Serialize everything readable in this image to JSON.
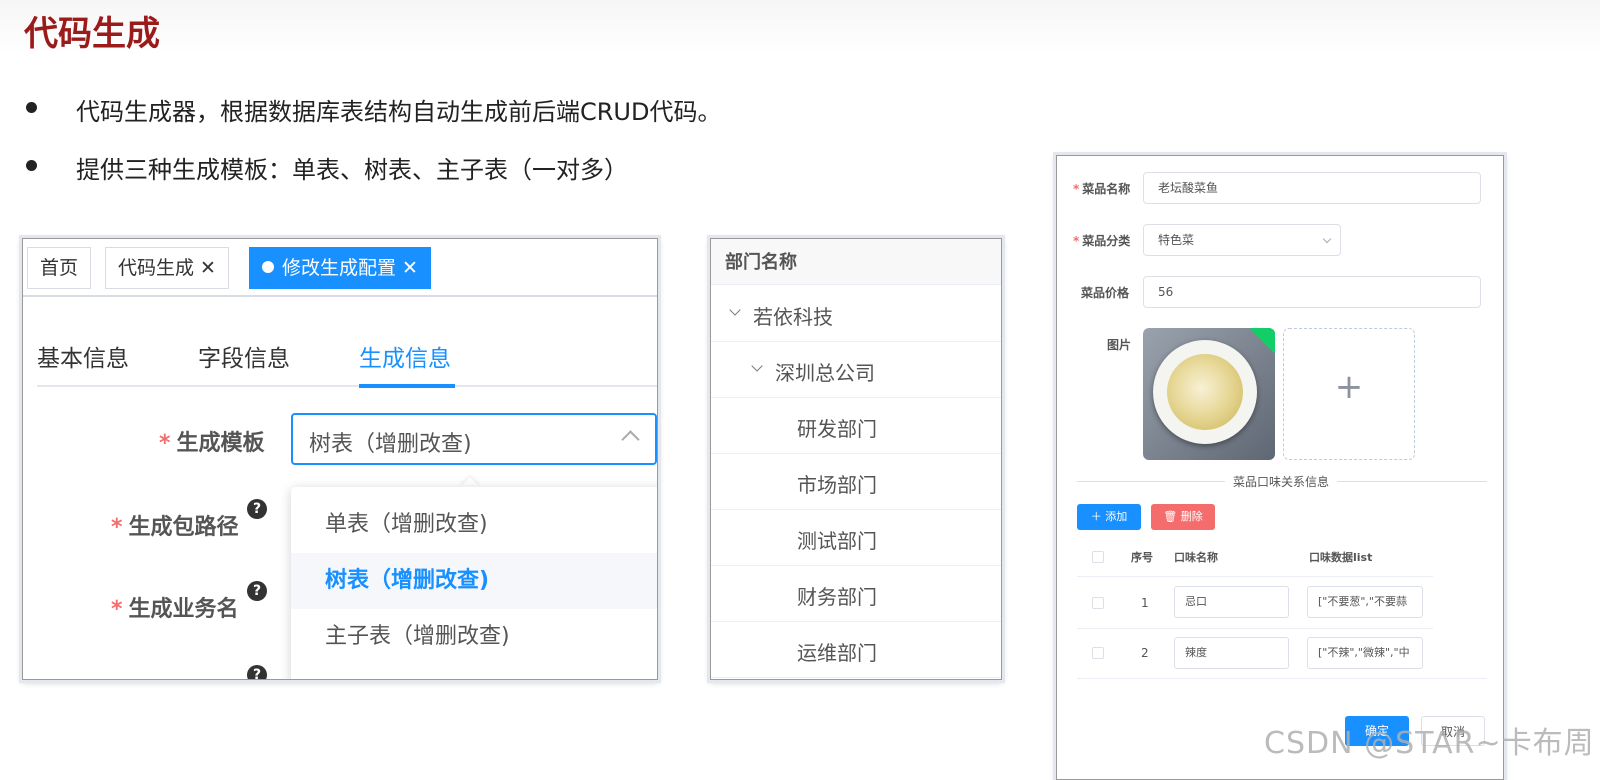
{
  "slide": {
    "title": "代码生成",
    "bullets": [
      "代码生成器，根据数据库表结构自动生成前后端CRUD代码。",
      "提供三种生成模板：单表、树表、主子表（一对多）"
    ]
  },
  "codegen_panel": {
    "tags": [
      {
        "label": "首页"
      },
      {
        "label": "代码生成",
        "close": "✕"
      },
      {
        "label": "修改生成配置",
        "close": "✕"
      }
    ],
    "tabs": [
      "基本信息",
      "字段信息",
      "生成信息"
    ],
    "active_tab": "生成信息",
    "fields": {
      "template": {
        "label": "生成模板",
        "value": "树表（增删改查)"
      },
      "package_path": {
        "label": "生成包路径"
      },
      "business_name": {
        "label": "生成业务名"
      }
    },
    "dropdown_options": [
      "单表（增删改查)",
      "树表（增删改查)",
      "主子表（增删改查)"
    ],
    "selected_option": "树表（增删改查)",
    "help_glyph": "?"
  },
  "tree_panel": {
    "header": "部门名称",
    "rows": [
      {
        "label": "若依科技",
        "level": 0,
        "expanded": true
      },
      {
        "label": "深圳总公司",
        "level": 1,
        "expanded": true
      },
      {
        "label": "研发部门",
        "level": 2
      },
      {
        "label": "市场部门",
        "level": 2
      },
      {
        "label": "测试部门",
        "level": 2
      },
      {
        "label": "财务部门",
        "level": 2
      },
      {
        "label": "运维部门",
        "level": 2
      }
    ]
  },
  "dish_form": {
    "name": {
      "label": "菜品名称",
      "value": "老坛酸菜鱼"
    },
    "category": {
      "label": "菜品分类",
      "value": "特色菜"
    },
    "price": {
      "label": "菜品价格",
      "value": "56"
    },
    "image": {
      "label": "图片",
      "upload_icon": "+"
    },
    "section_title": "菜品口味关系信息",
    "add_button": "＋ 添加",
    "delete_button": "🗑 删除",
    "table": {
      "headers": [
        "序号",
        "口味名称",
        "口味数据list"
      ],
      "rows": [
        {
          "index": "1",
          "name": "忌口",
          "list": "[\"不要葱\",\"不要蒜"
        },
        {
          "index": "2",
          "name": "辣度",
          "list": "[\"不辣\",\"微辣\",\"中"
        }
      ]
    },
    "confirm_button": "确定",
    "cancel_button": "取消"
  },
  "watermark": "CSDN @STAR~卡布周",
  "colors": {
    "title": "#9b1b1b",
    "primary": "#1890ff",
    "danger": "#f56c6c",
    "success": "#13ce66"
  }
}
